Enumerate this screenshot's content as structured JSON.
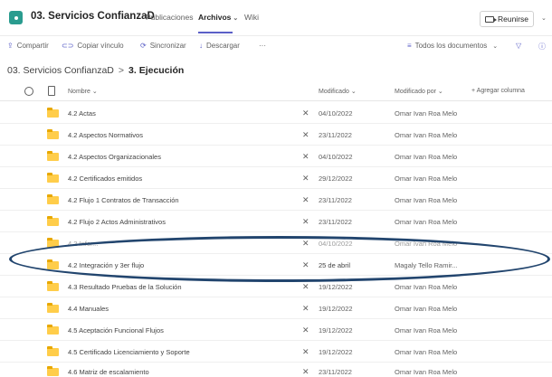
{
  "header": {
    "team_title": "03. Servicios ConfianzaD",
    "tabs": [
      {
        "label": "Publicaciones",
        "active": false
      },
      {
        "label": "Archivos",
        "active": true
      },
      {
        "label": "Wiki",
        "active": false
      }
    ],
    "meet_button": "Reunirse"
  },
  "commands": {
    "share": "Compartir",
    "copy_link": "Copiar vínculo",
    "sync": "Sincronizar",
    "download": "Descargar",
    "more": "···",
    "view": "Todos los documentos"
  },
  "breadcrumb": {
    "parent": "03. Servicios ConfianzaD",
    "separator": ">",
    "current": "3. Ejecución"
  },
  "columns": {
    "name": "Nombre",
    "modified": "Modificado",
    "modified_by": "Modificado por",
    "add_column": "+ Agregar columna"
  },
  "files": [
    {
      "name": "4.2 Actas",
      "modified": "04/10/2022",
      "modified_by": "Omar Ivan Roa Melo"
    },
    {
      "name": "4.2 Aspectos Normativos",
      "modified": "23/11/2022",
      "modified_by": "Omar Ivan Roa Melo"
    },
    {
      "name": "4.2 Aspectos Organizacionales",
      "modified": "04/10/2022",
      "modified_by": "Omar Ivan Roa Melo"
    },
    {
      "name": "4.2 Certificados emitidos",
      "modified": "29/12/2022",
      "modified_by": "Omar Ivan Roa Melo"
    },
    {
      "name": "4.2 Flujo 1 Contratos de Transacción",
      "modified": "23/11/2022",
      "modified_by": "Omar Ivan Roa Melo"
    },
    {
      "name": "4.2 Flujo 2 Actos Administrativos",
      "modified": "23/11/2022",
      "modified_by": "Omar Ivan Roa Melo"
    },
    {
      "name": "4.2 Infor...",
      "modified": "04/10/2022",
      "modified_by": "Omar Ivan Roa Melo"
    },
    {
      "name": "4.2 Integración y 3er flujo",
      "modified": "25 de abril",
      "modified_by": "Magaly Tello Ramir..."
    },
    {
      "name": "4.3 Resultado Pruebas de la Solución",
      "modified": "19/12/2022",
      "modified_by": "Omar Ivan Roa Melo"
    },
    {
      "name": "4.4 Manuales",
      "modified": "19/12/2022",
      "modified_by": "Omar Ivan Roa Melo"
    },
    {
      "name": "4.5 Aceptación Funcional Flujos",
      "modified": "19/12/2022",
      "modified_by": "Omar Ivan Roa Melo"
    },
    {
      "name": "4.5 Certificado Licenciamiento y Soporte",
      "modified": "19/12/2022",
      "modified_by": "Omar Ivan Roa Melo"
    },
    {
      "name": "4.6 Matriz de escalamiento",
      "modified": "23/11/2022",
      "modified_by": "Omar Ivan Roa Melo"
    }
  ],
  "colors": {
    "accent": "#5b5fc7",
    "team_icon": "#2a9c8f",
    "folder": "#ffcd4a",
    "annotation": "#22456e"
  },
  "icons": {
    "team": "team-icon",
    "folder": "folder-icon",
    "pin": "pin-off-icon",
    "filter": "filter-icon",
    "info": "info-icon",
    "camera": "camera-icon"
  }
}
